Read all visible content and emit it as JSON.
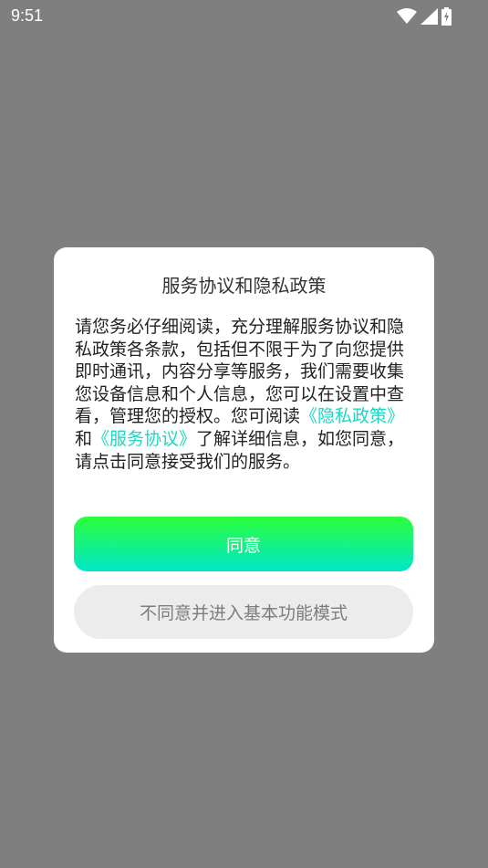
{
  "status_bar": {
    "time": "9:51",
    "icons": [
      "wifi-icon",
      "cellular-signal-icon",
      "battery-charging-icon"
    ]
  },
  "dialog": {
    "title": "服务协议和隐私政策",
    "body_start": "请您务必仔细阅读，充分理解服务协议和隐私政策各条款，包括但不限于为了向您提供即时通讯，内容分享等服务，我们需要收集您设备信息和个人信息，您可以在设置中查看，管理您的授权。您可阅读",
    "privacy_link": "《隐私政策》",
    "and_text": "和",
    "service_link": "《服务协议》",
    "body_end": "了解详细信息，如您同意，请点击同意接受我们的服务。",
    "agree_label": "同意",
    "disagree_label": "不同意并进入基本功能模式"
  },
  "colors": {
    "overlay": "#7f7f7f",
    "link": "#1ed7c1",
    "button_gradient_top": "#2cff3c",
    "button_gradient_bottom": "#00e6c8",
    "secondary_button": "#ececec"
  }
}
